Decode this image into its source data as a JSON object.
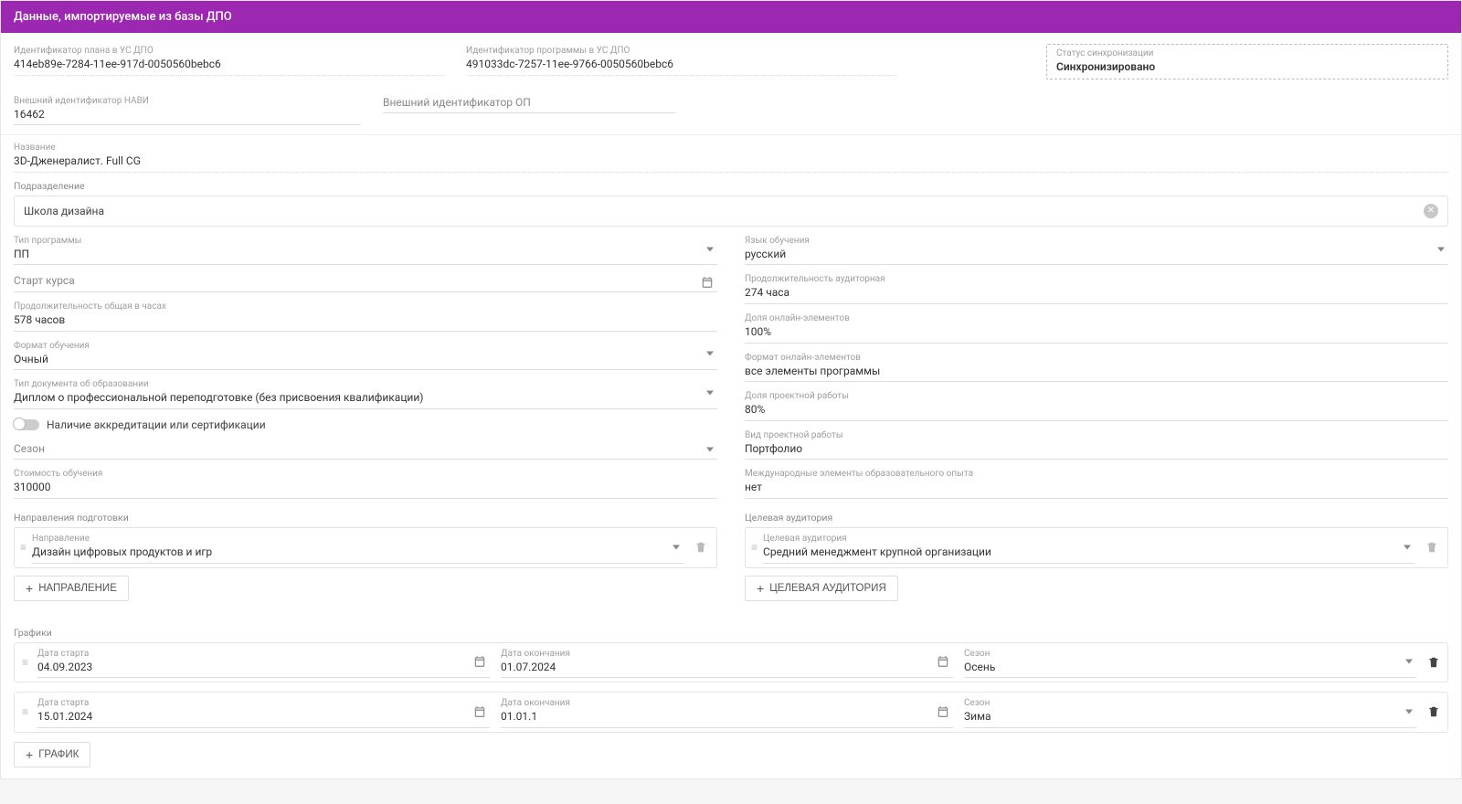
{
  "header": {
    "title": "Данные, импортируемые из базы ДПО"
  },
  "ids": {
    "plan_id_label": "Идентификатор плана в УС ДПО",
    "plan_id_value": "414eb89e-7284-11ee-917d-0050560bebc6",
    "program_id_label": "Идентификатор программы в УС ДПО",
    "program_id_value": "491033dc-7257-11ee-9766-0050560bebc6",
    "sync_status_label": "Статус синхронизации",
    "sync_status_value": "Синхронизировано",
    "ext_navi_label": "Внешний идентификатор НАВИ",
    "ext_navi_value": "16462",
    "ext_op_placeholder": "Внешний идентификатор ОП"
  },
  "program": {
    "name_label": "Название",
    "name_value": "3D-Дженералист. Full CG",
    "division_label": "Подразделение",
    "division_value": "Школа дизайна"
  },
  "left": {
    "type_label": "Тип программы",
    "type_value": "ПП",
    "start_placeholder": "Старт курса",
    "duration_total_label": "Продолжительность общая в часах",
    "duration_total_value": "578 часов",
    "format_label": "Формат обучения",
    "format_value": "Очный",
    "doc_label": "Тип документа об образовании",
    "doc_value": "Диплом о профессиональной переподготовке (без присвоения квалификации)",
    "accreditation_label": "Наличие аккредитации или сертификации",
    "season_placeholder": "Сезон",
    "cost_label": "Стоимость обучения",
    "cost_value": "310000"
  },
  "right": {
    "lang_label": "Язык обучения",
    "lang_value": "русский",
    "duration_aud_label": "Продолжительность аудиторная",
    "duration_aud_value": "274 часа",
    "online_share_label": "Доля онлайн-элементов",
    "online_share_value": "100%",
    "online_format_label": "Формат онлайн-элементов",
    "online_format_value": "все элементы программы",
    "project_share_label": "Доля проектной работы",
    "project_share_value": "80%",
    "project_type_label": "Вид проектной работы",
    "project_type_value": "Портфолио",
    "intl_label": "Международные элементы образовательного опыта",
    "intl_value": "нет"
  },
  "track": {
    "section_label": "Направления подготовки",
    "item_label": "Направление",
    "item_value": "Дизайн цифровых продуктов и игр",
    "add_button": "Направление"
  },
  "audience": {
    "section_label": "Целевая аудитория",
    "item_label": "Целевая аудитория",
    "item_value": "Средний менеджмент крупной организации",
    "add_button": "Целевая аудитория"
  },
  "schedule": {
    "section_label": "Графики",
    "start_label": "Дата старта",
    "end_label": "Дата окончания",
    "season_label": "Сезон",
    "rows": [
      {
        "start": "04.09.2023",
        "end": "01.07.2024",
        "season": "Осень"
      },
      {
        "start": "15.01.2024",
        "end": "01.01.1",
        "season": "Зима"
      }
    ],
    "add_button": "График"
  }
}
